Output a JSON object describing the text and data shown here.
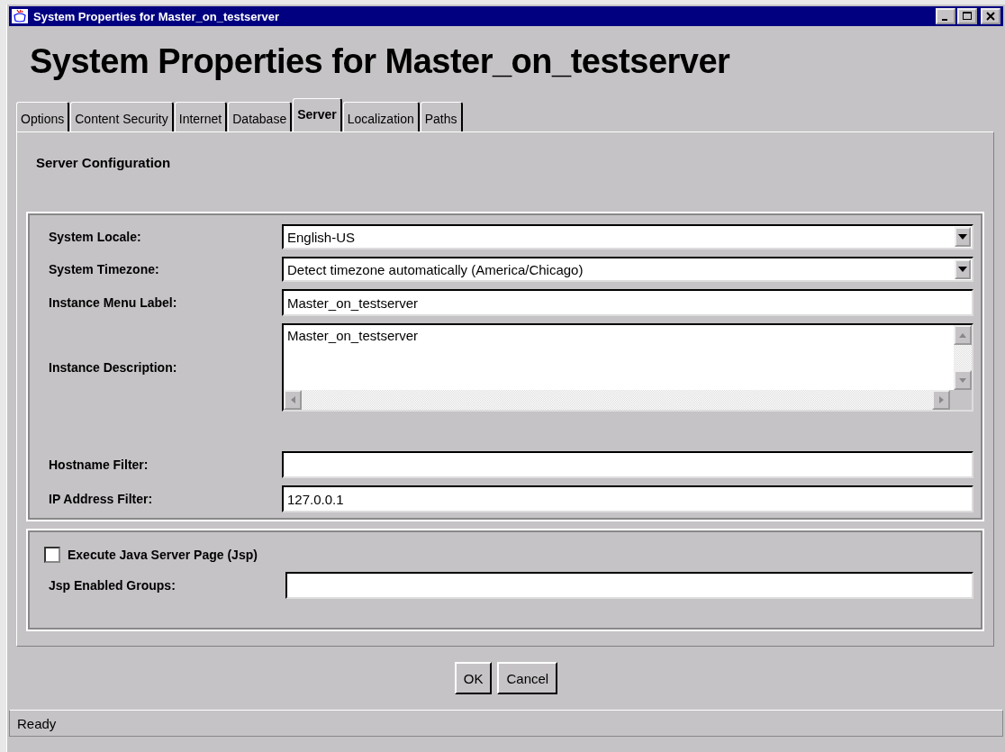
{
  "window": {
    "title": "System Properties for Master_on_testserver"
  },
  "heading": "System Properties for Master_on_testserver",
  "tabs": [
    {
      "label": "Options",
      "selected": false
    },
    {
      "label": "Content Security",
      "selected": false
    },
    {
      "label": "Internet",
      "selected": false
    },
    {
      "label": "Database",
      "selected": false
    },
    {
      "label": "Server",
      "selected": true
    },
    {
      "label": "Localization",
      "selected": false
    },
    {
      "label": "Paths",
      "selected": false
    }
  ],
  "section_title": "Server Configuration",
  "fields": [
    {
      "label": "System Locale:",
      "kind": "dropdown",
      "value": "English-US"
    },
    {
      "label": "System Timezone:",
      "kind": "dropdown",
      "value": "Detect timezone automatically (America/Chicago)"
    },
    {
      "label": "Instance Menu Label:",
      "kind": "text",
      "value": "Master_on_testserver"
    },
    {
      "label": "Instance Description:",
      "kind": "textarea",
      "value": "Master_on_testserver"
    },
    {
      "label": "Hostname Filter:",
      "kind": "text"
    },
    {
      "label": "IP Address Filter:",
      "kind": "text",
      "value": "127.0.0.1"
    }
  ],
  "jsp": {
    "checkbox": {
      "label": "Execute Java Server Page (Jsp)",
      "checked": false
    },
    "groups_field": {
      "label": "Jsp Enabled Groups:"
    }
  },
  "buttons": [
    "OK",
    "Cancel"
  ],
  "status_bar": "Ready"
}
